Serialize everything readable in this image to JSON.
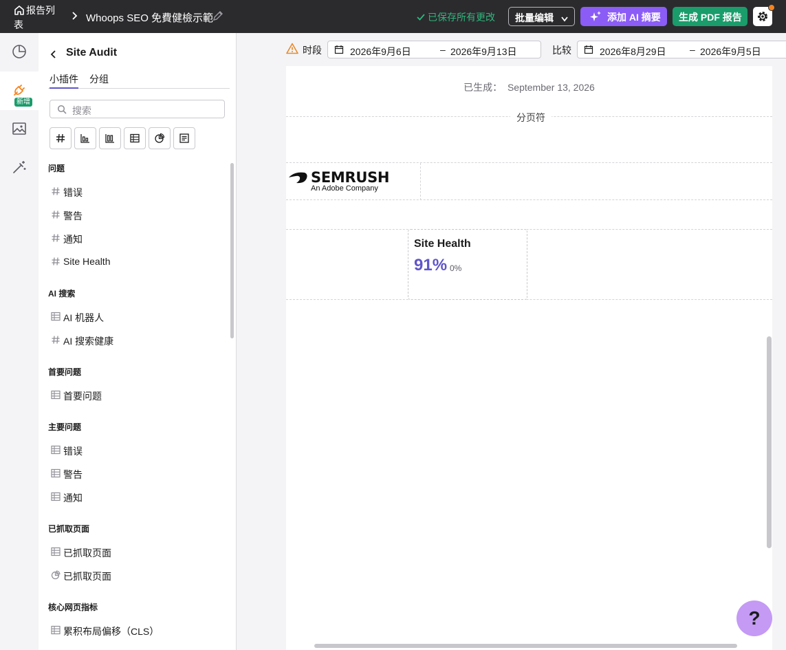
{
  "topbar": {
    "home_label": "报告列表",
    "report_title": "Whoops SEO 免費健檢示範",
    "saved_status": "已保存所有更改",
    "bulk_edit_label": "批量编辑",
    "ai_summary_label": "添加 AI 摘要",
    "pdf_label": "生成 PDF 报告"
  },
  "rail": {
    "new_badge": "新增"
  },
  "sidebar": {
    "title": "Site Audit",
    "tabs": [
      "小插件",
      "分组"
    ],
    "search_placeholder": "搜索",
    "sections": [
      {
        "title": "问题",
        "items": [
          {
            "icon": "hash-icon",
            "label": "错误"
          },
          {
            "icon": "hash-icon",
            "label": "警告"
          },
          {
            "icon": "hash-icon",
            "label": "通知"
          },
          {
            "icon": "hash-icon",
            "label": "Site Health"
          }
        ]
      },
      {
        "title": "AI 搜索",
        "items": [
          {
            "icon": "table-icon",
            "label": "AI 机器人"
          },
          {
            "icon": "hash-icon",
            "label": "AI 搜索健康"
          }
        ]
      },
      {
        "title": "首要问题",
        "items": [
          {
            "icon": "table-icon",
            "label": "首要问题"
          }
        ]
      },
      {
        "title": "主要问题",
        "items": [
          {
            "icon": "table-icon",
            "label": "错误"
          },
          {
            "icon": "table-icon",
            "label": "警告"
          },
          {
            "icon": "table-icon",
            "label": "通知"
          }
        ]
      },
      {
        "title": "已抓取页面",
        "items": [
          {
            "icon": "table-icon",
            "label": "已抓取页面"
          },
          {
            "icon": "pie-icon",
            "label": "已抓取页面"
          }
        ]
      },
      {
        "title": "核心网页指标",
        "items": [
          {
            "icon": "table-icon",
            "label": "累积布局偏移（CLS）"
          }
        ]
      }
    ]
  },
  "filters": {
    "period_label": "时段",
    "period_start": "2026年9月6日",
    "period_end": "2026年9月13日",
    "compare_label": "比较",
    "compare_start": "2026年8月29日",
    "compare_end": "2026年9月5日",
    "dash": "–"
  },
  "canvas": {
    "generated_label": "已生成：",
    "generated_date": "September 13, 2026",
    "page_break_label": "分页符",
    "logo_text": "SEMRUSH",
    "logo_sub": "An Adobe Company",
    "widget": {
      "title": "Site Health",
      "value": "91%",
      "delta": "0%"
    }
  },
  "help_label": "?",
  "colors": {
    "accent": "#5f55c9",
    "ai_button": "#8b5cf6",
    "pdf_button": "#1a9c6b",
    "saved": "#2fb67c",
    "topbar": "#2b2b2e"
  }
}
